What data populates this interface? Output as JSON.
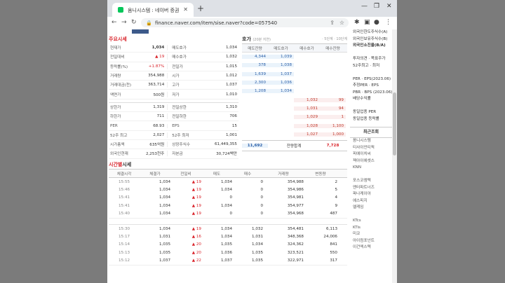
{
  "browser": {
    "tab_title": "옴니시스템 : 네이버 증권",
    "url": "finance.naver.com/item/sise.naver?code=057540"
  },
  "main_quote": {
    "title": "주요시세",
    "left_rows": [
      {
        "label": "현재가",
        "value": "1,034",
        "bold": true
      },
      {
        "label": "전일대비",
        "value": "▲ 19",
        "up": true
      },
      {
        "label": "등락률(%)",
        "value": "+1.87%",
        "up": true
      },
      {
        "label": "거래량",
        "value": "354,988"
      },
      {
        "label": "거래대금(천)",
        "value": "363,714"
      },
      {
        "label": "액면가",
        "value": "500원"
      },
      {
        "label": "상한가",
        "value": "1,319",
        "gap": true
      },
      {
        "label": "하한가",
        "value": "711"
      },
      {
        "label": "PER",
        "value": "68.93"
      },
      {
        "label": "52주 최고",
        "value": "2,027"
      },
      {
        "label": "시가총액",
        "value": "635억원"
      },
      {
        "label": "외국인현재",
        "value": "2,253천주"
      }
    ],
    "right_rows": [
      {
        "label": "매도호가",
        "value": "1,034"
      },
      {
        "label": "매수호가",
        "value": "1,032"
      },
      {
        "label": "전일가",
        "value": "1,015"
      },
      {
        "label": "시가",
        "value": "1,012"
      },
      {
        "label": "고가",
        "value": "1,037"
      },
      {
        "label": "저가",
        "value": "1,010"
      },
      {
        "label": "전일상한",
        "value": "1,310",
        "gap": true
      },
      {
        "label": "전일하한",
        "value": "706"
      },
      {
        "label": "EPS",
        "value": "15"
      },
      {
        "label": "52주 최저",
        "value": "1,001"
      },
      {
        "label": "상장주식수",
        "value": "61,449,355"
      },
      {
        "label": "자본금",
        "value": "30,724백만"
      }
    ]
  },
  "orderbook": {
    "title": "호가",
    "subtitle": "(20분 지연)",
    "links": "· 5단계 · 10단계",
    "headers": [
      "매도잔량",
      "매도호가",
      "매수호가",
      "매수잔량"
    ],
    "asks": [
      {
        "qty": "4,344",
        "price": "1,039"
      },
      {
        "qty": "378",
        "price": "1,038"
      },
      {
        "qty": "1,639",
        "price": "1,037"
      },
      {
        "qty": "2,300",
        "price": "1,036"
      },
      {
        "qty": "1,208",
        "price": "1,034"
      }
    ],
    "bids": [
      {
        "price": "1,032",
        "qty": "99"
      },
      {
        "price": "1,031",
        "qty": "94"
      },
      {
        "price": "1,029",
        "qty": "1"
      },
      {
        "price": "1,028",
        "qty": "1,100"
      },
      {
        "price": "1,027",
        "qty": "1,000"
      }
    ],
    "total_sell": "11,692",
    "total_label": "잔량합계",
    "total_buy": "7,728"
  },
  "tick": {
    "title_hl": "시간별",
    "title_rest": "시세",
    "headers": [
      "체결시각",
      "체결가",
      "전일비",
      "매도",
      "매수",
      "거래량",
      "변동량"
    ],
    "group1": [
      [
        "15:55",
        "1,034",
        "▲ 19",
        "1,034",
        "0",
        "354,988",
        "2"
      ],
      [
        "15:46",
        "1,034",
        "▲ 19",
        "1,034",
        "0",
        "354,986",
        "5"
      ],
      [
        "15:41",
        "1,034",
        "▲ 19",
        "0",
        "0",
        "354,981",
        "4"
      ],
      [
        "15:41",
        "1,034",
        "▲ 19",
        "1,034",
        "0",
        "354,977",
        "9"
      ],
      [
        "15:40",
        "1,034",
        "▲ 19",
        "0",
        "0",
        "354,968",
        "487"
      ]
    ],
    "group2": [
      [
        "15:30",
        "1,034",
        "▲ 19",
        "1,034",
        "1,032",
        "354,481",
        "6,113"
      ],
      [
        "15:17",
        "1,031",
        "▲ 16",
        "1,034",
        "1,031",
        "348,368",
        "24,006"
      ],
      [
        "15:14",
        "1,035",
        "▲ 20",
        "1,035",
        "1,034",
        "324,362",
        "841"
      ],
      [
        "15:13",
        "1,035",
        "▲ 20",
        "1,036",
        "1,035",
        "323,521",
        "550"
      ],
      [
        "15:12",
        "1,037",
        "▲ 22",
        "1,037",
        "1,035",
        "322,971",
        "317"
      ]
    ]
  },
  "sidebar": {
    "top_items": [
      {
        "text": "외국인한도주식수(A)"
      },
      {
        "text": "외국인보유주식수(B)"
      },
      {
        "text": "외국인소진율(B/A)",
        "bold": true
      },
      {
        "text": ""
      },
      {
        "text": "투자의견 · 목표주가"
      },
      {
        "text": "52주최고 · 최저"
      },
      {
        "text": ""
      },
      {
        "text": "PER · EPS(2023.06)"
      },
      {
        "text": "추정PER · EPS"
      },
      {
        "text": "PBR · BPS (2023.06)"
      },
      {
        "text": "배당수익률"
      },
      {
        "text": ""
      },
      {
        "text": "동일업종 PER"
      },
      {
        "text": "동일업종 등락률"
      }
    ],
    "recent_title": "최근조회",
    "recent_items": [
      "옴니시스템",
      "티사이언티픽",
      "피에이치씨",
      "젝아이에셋스",
      "KNN",
      "",
      "포스코엠텍",
      "엔터파트너즈",
      "파나케이아",
      "에스피지",
      "엘케임",
      "",
      "KTcs",
      "KTis",
      "미코",
      "아이컴포넌트",
      "이건엑스텍"
    ]
  }
}
